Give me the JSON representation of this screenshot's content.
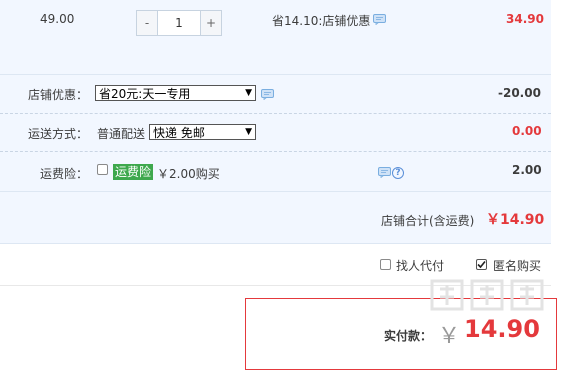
{
  "item": {
    "unit_price": "49.00",
    "qty_minus": "-",
    "qty_value": "1",
    "qty_plus": "+",
    "discount_text": "省14.10:店铺优惠",
    "subtotal": "34.90"
  },
  "shop_discount": {
    "label": "店铺优惠：",
    "selected": "省20元:天一专用",
    "amount": "-20.00"
  },
  "shipping": {
    "label": "运送方式：",
    "method": "普通配送",
    "selected": "快递 免邮",
    "amount": "0.00"
  },
  "insurance": {
    "label": "运费险：",
    "tag": "运费险",
    "price_text": "￥2.00购买",
    "amount": "2.00"
  },
  "shop_total": {
    "label": "店铺合计(含运费)",
    "amount": "￥14.90"
  },
  "options": {
    "proxy_pay_label": "找人代付",
    "anonymous_label": "匿名购买",
    "anonymous_checked": true
  },
  "payment": {
    "label": "实付款：",
    "currency": "￥",
    "amount": "14.90"
  },
  "colors": {
    "accent_red": "#e4393c",
    "panel_bg": "#f2f7ff",
    "insurance_green": "#3ea84d"
  }
}
